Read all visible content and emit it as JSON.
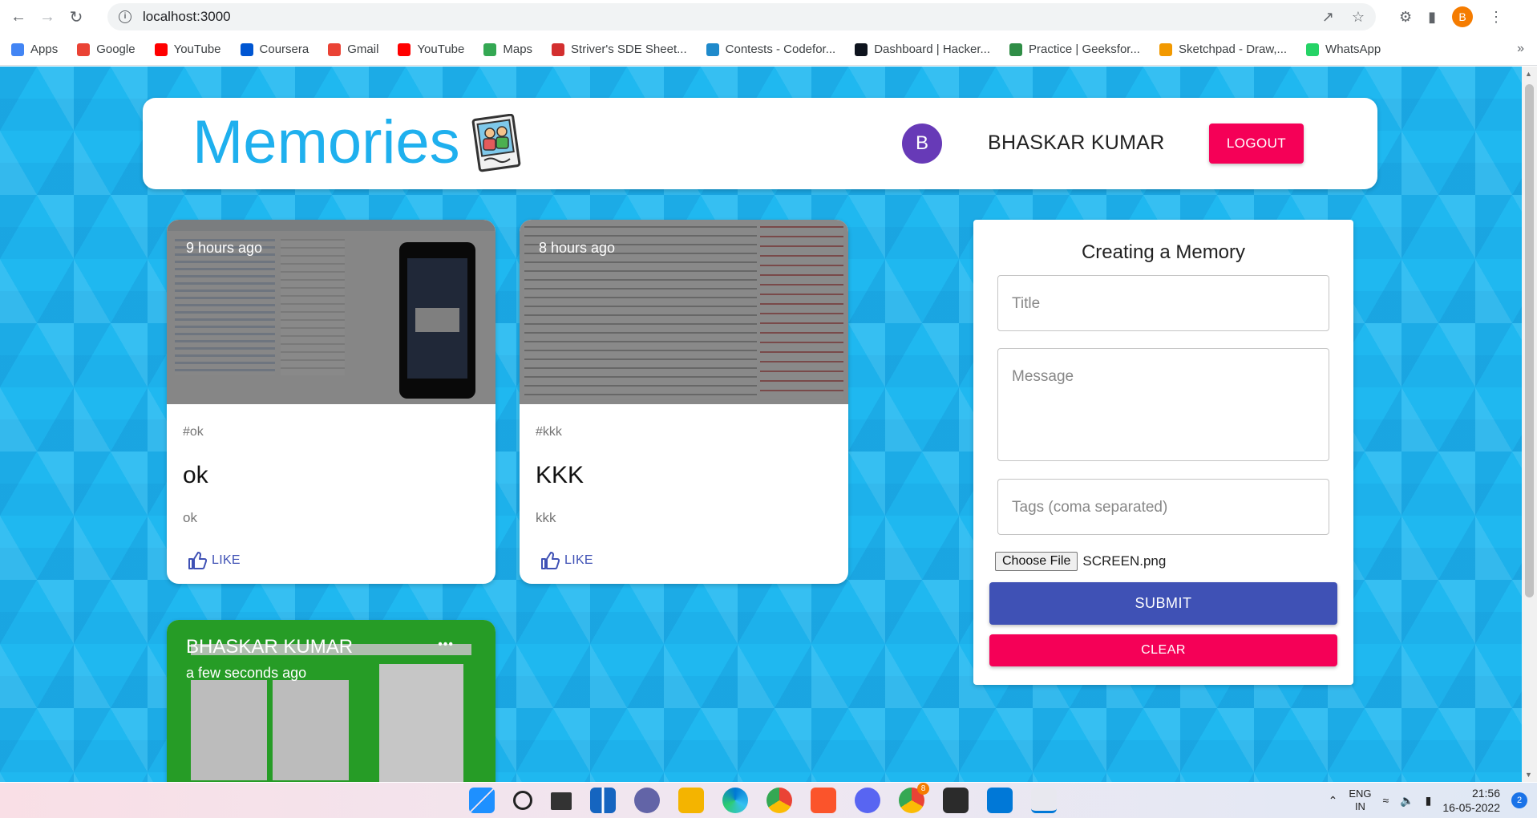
{
  "browser": {
    "url": "localhost:3000",
    "profile_initial": "B"
  },
  "bookmarks": [
    {
      "label": "Apps",
      "icon": "apps-grid-icon",
      "color": "#4285f4"
    },
    {
      "label": "Google",
      "icon": "google-icon",
      "color": "#ea4335"
    },
    {
      "label": "YouTube",
      "icon": "youtube-icon",
      "color": "#ff0000"
    },
    {
      "label": "Coursera",
      "icon": "coursera-icon",
      "color": "#0056d2"
    },
    {
      "label": "Gmail",
      "icon": "gmail-icon",
      "color": "#ea4335"
    },
    {
      "label": "YouTube",
      "icon": "youtube-icon",
      "color": "#ff0000"
    },
    {
      "label": "Maps",
      "icon": "maps-icon",
      "color": "#34a853"
    },
    {
      "label": "Striver's SDE Sheet...",
      "icon": "tuf-icon",
      "color": "#d32f2f"
    },
    {
      "label": "Contests - Codefor...",
      "icon": "codeforces-icon",
      "color": "#1f8acb"
    },
    {
      "label": "Dashboard | Hacker...",
      "icon": "hackerrank-icon",
      "color": "#0e141e"
    },
    {
      "label": "Practice | Geeksfor...",
      "icon": "gfg-icon",
      "color": "#2f8d46"
    },
    {
      "label": "Sketchpad - Draw,...",
      "icon": "sketchpad-icon",
      "color": "#f29900"
    },
    {
      "label": "WhatsApp",
      "icon": "whatsapp-icon",
      "color": "#25d366"
    }
  ],
  "app": {
    "title": "Memories",
    "user_initial": "B",
    "user_name": "BHASKAR KUMAR",
    "logout_label": "LOGOUT"
  },
  "posts": [
    {
      "time": "9 hours ago",
      "tags": "#ok",
      "title": "ok",
      "message": "ok",
      "like_label": "LIKE"
    },
    {
      "time": "8 hours ago",
      "tags": "#kkk",
      "title": "KKK",
      "message": "kkk",
      "like_label": "LIKE"
    },
    {
      "creator": "BHASKAR KUMAR",
      "time": "a few seconds ago",
      "more": "•••"
    }
  ],
  "form": {
    "title": "Creating a Memory",
    "title_placeholder": "Title",
    "message_placeholder": "Message",
    "tags_placeholder": "Tags (coma separated)",
    "file_button": "Choose File",
    "file_name": "SCREEN.png",
    "submit_label": "SUBMIT",
    "clear_label": "CLEAR"
  },
  "colors": {
    "accent_blue": "#1fb0ee",
    "primary": "#3f51b5",
    "secondary": "#f50057",
    "avatar": "#673ab7"
  },
  "taskbar": {
    "language": "ENG",
    "region": "IN",
    "time": "21:56",
    "date": "16-05-2022",
    "notifications": "2",
    "chrome_badge": "8"
  }
}
